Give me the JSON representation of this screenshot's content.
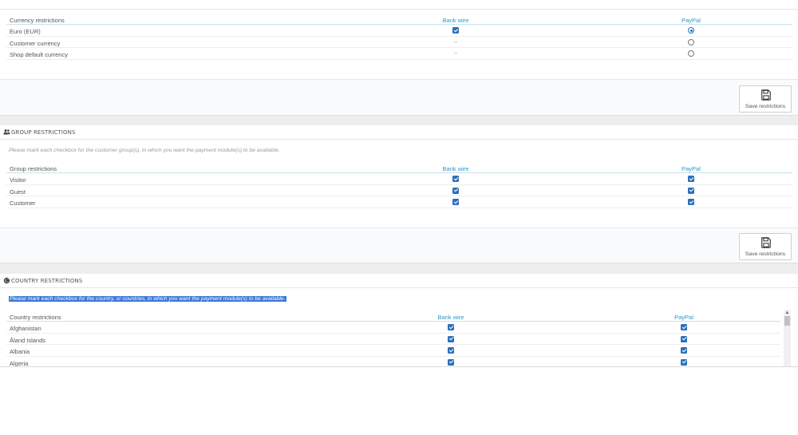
{
  "currency": {
    "header": {
      "label": "Currency restrictions",
      "col1": "Bank wire",
      "col2": "PayPal"
    },
    "rows": [
      {
        "label": "Euro (EUR)",
        "bank": "check",
        "paypal": "radio-on"
      },
      {
        "label": "Customer currency",
        "bank": "--",
        "paypal": "radio-off"
      },
      {
        "label": "Shop default currency",
        "bank": "--",
        "paypal": "radio-off"
      }
    ],
    "save_label": "Save restrictions"
  },
  "group": {
    "title": "GROUP RESTRICTIONS",
    "help": "Please mark each checkbox for the customer group(s), in which you want the payment module(s) to be available.",
    "header": {
      "label": "Group restrictions",
      "col1": "Bank wire",
      "col2": "PayPal"
    },
    "rows": [
      {
        "label": "Visitor",
        "bank": "check",
        "paypal": "check"
      },
      {
        "label": "Guest",
        "bank": "check",
        "paypal": "check"
      },
      {
        "label": "Customer",
        "bank": "check",
        "paypal": "check"
      }
    ],
    "save_label": "Save restrictions"
  },
  "country": {
    "title": "COUNTRY RESTRICTIONS",
    "help": "Please mark each checkbox for the country, or countries, in which you want the payment module(s) to be available.",
    "header": {
      "label": "Country restrictions",
      "col1": "Bank wire",
      "col2": "PayPal"
    },
    "rows": [
      {
        "label": "Afghanistan",
        "bank": "check",
        "paypal": "check"
      },
      {
        "label": "Åland Islands",
        "bank": "check",
        "paypal": "check"
      },
      {
        "label": "Albania",
        "bank": "check",
        "paypal": "check"
      },
      {
        "label": "Algeria",
        "bank": "check",
        "paypal": "check"
      }
    ]
  },
  "icons": {
    "group_header": "users-icon",
    "country_header": "globe-icon",
    "save": "floppy-disk-icon"
  },
  "colors": {
    "accent": "#2c98c7",
    "checkbox": "#2c6fbb",
    "selection": "#3a78d8"
  }
}
